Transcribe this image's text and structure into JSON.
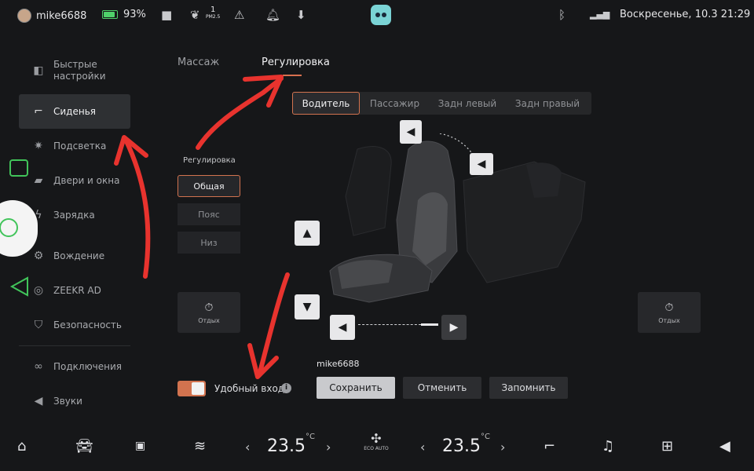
{
  "status": {
    "username": "mike6688",
    "battery": "93%",
    "pm_value": "1",
    "pm_unit": "PM2.5",
    "datetime": "Воскресенье, 10.3 21:29"
  },
  "sidebar": {
    "items": [
      {
        "label": "Быстрые настройки",
        "icon": "toggle-icon"
      },
      {
        "label": "Сиденья",
        "icon": "seat-icon",
        "active": true
      },
      {
        "label": "Подсветка",
        "icon": "light-icon"
      },
      {
        "label": "Двери и окна",
        "icon": "car-door-icon"
      },
      {
        "label": "Зарядка",
        "icon": "charging-icon"
      },
      {
        "label": "Вождение",
        "icon": "driving-icon"
      },
      {
        "label": "ZEEKR AD",
        "icon": "steering-wheel-icon"
      },
      {
        "label": "Безопасность",
        "icon": "shield-icon"
      },
      {
        "label": "Подключения",
        "icon": "link-icon"
      },
      {
        "label": "Звуки",
        "icon": "speaker-icon"
      }
    ]
  },
  "tabs": {
    "massage": "Массаж",
    "adjust": "Регулировка"
  },
  "seats": {
    "driver": "Водитель",
    "passenger": "Пассажир",
    "rear_left": "Задн левый",
    "rear_right": "Задн правый"
  },
  "adjustment": {
    "label": "Регулировка",
    "general": "Общая",
    "lumbar": "Пояс",
    "bottom": "Низ"
  },
  "rest": {
    "left": "Отдых",
    "right": "Отдых"
  },
  "profile": {
    "user": "mike6688",
    "save": "Сохранить",
    "cancel": "Отменить",
    "remember": "Запомнить"
  },
  "easy_entry": {
    "label": "Удобный вход",
    "enabled": true
  },
  "climate": {
    "left_temp": "23.5",
    "right_temp": "23.5",
    "unit": "°C",
    "fan_label": "ECO AUTO"
  },
  "colors": {
    "accent": "#d2734f",
    "annotation_red": "#e8332e",
    "annotation_green": "#41c45a"
  }
}
